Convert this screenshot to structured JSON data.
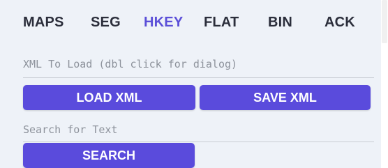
{
  "tabs": [
    {
      "label": "MAPS",
      "active": false
    },
    {
      "label": "SEG",
      "active": false
    },
    {
      "label": "HKEY",
      "active": true
    },
    {
      "label": "FLAT",
      "active": false
    },
    {
      "label": "BIN",
      "active": false
    },
    {
      "label": "ACK",
      "active": false
    }
  ],
  "xml_field": {
    "placeholder": "XML To Load (dbl click for dialog)",
    "value": ""
  },
  "buttons": {
    "load_xml": "LOAD XML",
    "save_xml": "SAVE XML",
    "search": "SEARCH"
  },
  "search_field": {
    "placeholder": "Search for Text",
    "value": ""
  },
  "colors": {
    "accent": "#5a4bdc",
    "active_tab": "#5b4fd8",
    "tab_text": "#2b2e3b",
    "panel_bg": "#eef2f8"
  }
}
